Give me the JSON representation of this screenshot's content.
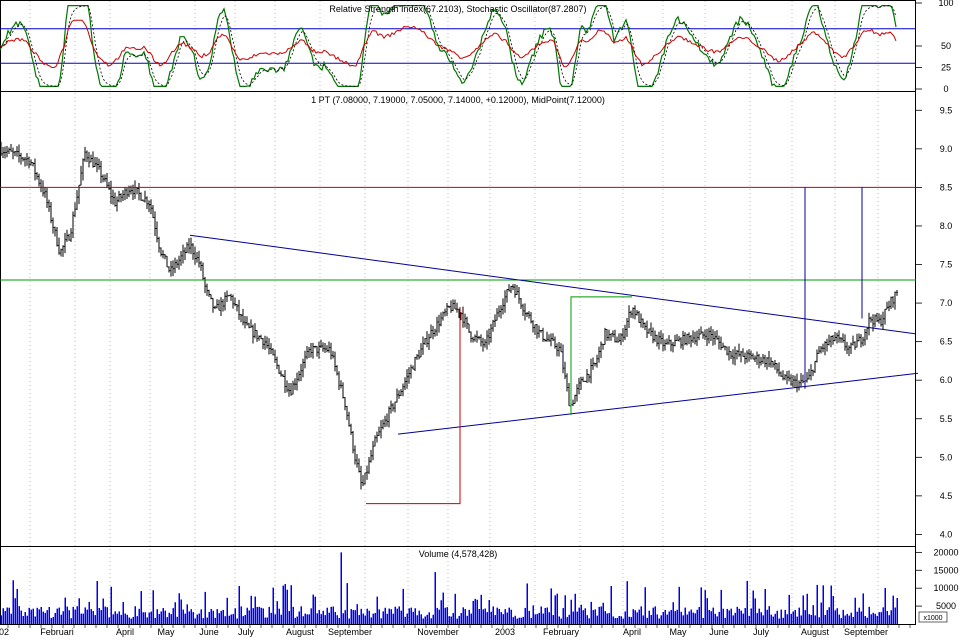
{
  "chart_data": [
    {
      "type": "line",
      "panel": "indicator",
      "title": "Relative Strength Index(67.2103), Stochastic Oscillator(87.2807)",
      "ylim": [
        0,
        100
      ],
      "y_ticks": [
        "100",
        "50",
        "25",
        "0"
      ],
      "reference_lines": [
        70,
        30
      ],
      "series": [
        {
          "name": "Relative Strength Index",
          "color": "#cc0000"
        },
        {
          "name": "Stochastic Oscillator",
          "color": "#007700",
          "color2": "#000000"
        }
      ],
      "colors": {
        "reference": "#0000cc"
      }
    },
    {
      "type": "ohlc",
      "panel": "price",
      "title": "1 PT (7.08000, 7.19000, 7.05000, 7.14000, +0.12000), MidPoint(7.12000)",
      "ylim": [
        4.0,
        9.5
      ],
      "y_ticks": [
        "9.5",
        "9.0",
        "8.5",
        "8.0",
        "7.5",
        "7.0",
        "6.5",
        "6.0",
        "5.5",
        "5.0",
        "4.5",
        "4.0"
      ],
      "last": {
        "open": 7.08,
        "high": 7.19,
        "low": 7.05,
        "close": 7.14,
        "change": 0.12,
        "midpoint": 7.12
      },
      "price_path": [
        [
          0,
          9.0
        ],
        [
          30,
          8.85
        ],
        [
          45,
          8.4
        ],
        [
          60,
          7.65
        ],
        [
          70,
          7.9
        ],
        [
          85,
          8.95
        ],
        [
          100,
          8.7
        ],
        [
          115,
          8.3
        ],
        [
          130,
          8.5
        ],
        [
          150,
          8.3
        ],
        [
          160,
          7.7
        ],
        [
          170,
          7.4
        ],
        [
          190,
          7.75
        ],
        [
          200,
          7.5
        ],
        [
          206,
          7.15
        ],
        [
          215,
          6.9
        ],
        [
          230,
          7.1
        ],
        [
          245,
          6.7
        ],
        [
          265,
          6.5
        ],
        [
          290,
          5.85
        ],
        [
          310,
          6.4
        ],
        [
          330,
          6.4
        ],
        [
          345,
          5.7
        ],
        [
          355,
          5.0
        ],
        [
          362,
          4.6
        ],
        [
          375,
          5.2
        ],
        [
          390,
          5.6
        ],
        [
          400,
          5.85
        ],
        [
          415,
          6.25
        ],
        [
          430,
          6.6
        ],
        [
          450,
          6.95
        ],
        [
          460,
          6.9
        ],
        [
          470,
          6.6
        ],
        [
          485,
          6.45
        ],
        [
          500,
          6.95
        ],
        [
          512,
          7.25
        ],
        [
          525,
          6.9
        ],
        [
          540,
          6.6
        ],
        [
          560,
          6.4
        ],
        [
          570,
          5.65
        ],
        [
          580,
          5.95
        ],
        [
          595,
          6.2
        ],
        [
          605,
          6.6
        ],
        [
          620,
          6.5
        ],
        [
          632,
          6.95
        ],
        [
          645,
          6.65
        ],
        [
          665,
          6.45
        ],
        [
          690,
          6.55
        ],
        [
          710,
          6.6
        ],
        [
          730,
          6.35
        ],
        [
          750,
          6.3
        ],
        [
          770,
          6.25
        ],
        [
          785,
          6.0
        ],
        [
          800,
          5.95
        ],
        [
          808,
          6.0
        ],
        [
          820,
          6.4
        ],
        [
          835,
          6.55
        ],
        [
          850,
          6.4
        ],
        [
          862,
          6.55
        ],
        [
          870,
          6.8
        ],
        [
          880,
          6.75
        ],
        [
          890,
          7.0
        ],
        [
          897,
          7.14
        ]
      ],
      "lines": [
        {
          "name": "resistance-8.5",
          "color": "#cc0000",
          "y": 8.5
        },
        {
          "name": "resistance-7.3",
          "color": "#009900",
          "y": 7.3
        },
        {
          "name": "descending-trendline",
          "color": "#000099",
          "from": [
            190,
            7.88
          ],
          "to": [
            916,
            6.6
          ]
        },
        {
          "name": "ascending-trendline",
          "color": "#000099",
          "from": [
            398,
            5.3
          ],
          "to": [
            918,
            6.09
          ]
        },
        {
          "name": "measured-move-red",
          "color": "#cc0000",
          "points": [
            [
              366,
              4.4
            ],
            [
              460,
              4.4
            ],
            [
              460,
              6.95
            ]
          ]
        },
        {
          "name": "measured-move-green",
          "color": "#009900",
          "points": [
            [
              571,
              5.55
            ],
            [
              571,
              7.08
            ],
            [
              632,
              7.08
            ]
          ]
        },
        {
          "name": "target-line-1",
          "color": "#000099",
          "points": [
            [
              805,
              5.9
            ],
            [
              805,
              8.5
            ]
          ]
        },
        {
          "name": "target-line-2",
          "color": "#000099",
          "points": [
            [
              862,
              6.8
            ],
            [
              862,
              8.5
            ]
          ]
        }
      ]
    },
    {
      "type": "bar",
      "panel": "volume",
      "title": "Volume (4,578,428)",
      "ylim": [
        0,
        20000
      ],
      "y_ticks": [
        "20000",
        "15000",
        "10000",
        "5000"
      ],
      "unit_label": "x1000",
      "color": "#0000ee"
    }
  ],
  "x_axis": {
    "labels": [
      "02",
      "Februari",
      "April",
      "May",
      "June",
      "July",
      "August",
      "September",
      "November",
      "2003",
      "February",
      "April",
      "May",
      "June",
      "July",
      "August",
      "September"
    ]
  }
}
